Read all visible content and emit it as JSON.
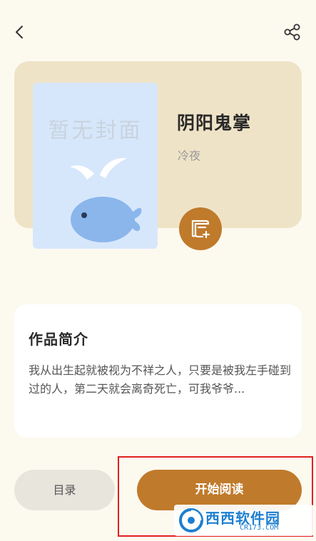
{
  "header": {
    "back_icon": "chevron-left-icon",
    "share_icon": "share-icon"
  },
  "book": {
    "cover_placeholder": "暂无封面",
    "title": "阴阳鬼掌",
    "author": "冷夜",
    "add_shelf_icon": "add-to-shelf-icon"
  },
  "intro": {
    "heading": "作品简介",
    "text": "我从出生起就被视为不祥之人，只要是被我左手碰到过的人，第二天就会离奇死亡，可我爷爷..."
  },
  "actions": {
    "catalog_label": "目录",
    "read_label": "开始阅读"
  },
  "watermark": {
    "text": "西西软件园",
    "sub": "CR173.COM"
  },
  "colors": {
    "accent": "#c07a2b",
    "background": "#fcf9ef",
    "card": "#efe3c7",
    "highlight": "#e0201e"
  }
}
